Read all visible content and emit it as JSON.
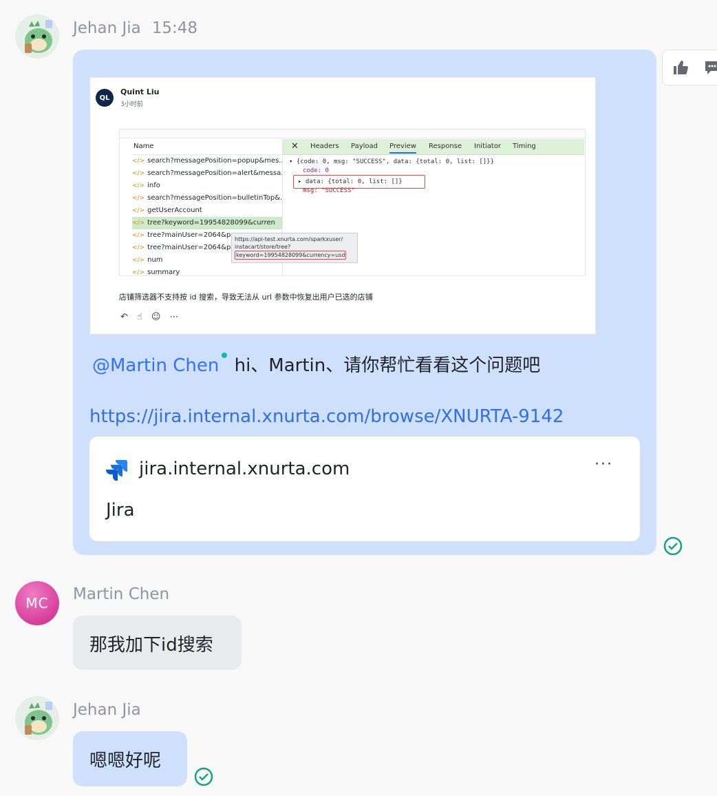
{
  "messages": {
    "m1": {
      "sender": "Jehan Jia",
      "time": "15:48",
      "screenshot": {
        "author_initials": "QL",
        "author_name": "Quint Liu",
        "author_time": "3小时前",
        "devtools": {
          "name_header": "Name",
          "requests": [
            "search?messagePosition=popup&mes...",
            "search?messagePosition=alert&messa...",
            "info",
            "search?messagePosition=bulletinTop&...",
            "getUserAccount",
            "tree?keyword=19954828099&curren",
            "tree?mainUser=2064&pag",
            "tree?mainUser=2064&pag",
            "num",
            "summary"
          ],
          "tabs": [
            "Headers",
            "Payload",
            "Preview",
            "Response",
            "Initiator",
            "Timing"
          ],
          "preview_line1": "▾ {code: 0, msg: \"SUCCESS\", data: {total: 0, list: []}}",
          "preview_code": "code: 0",
          "preview_data": "▸ data: {total: 0, list: []}",
          "preview_msg": "msg: \"SUCCESS\"",
          "tooltip_line1": "https://api-test.xnurta.com/sparkxuser/",
          "tooltip_line2": "instacart/store/tree?",
          "tooltip_line3": "keyword=19954828099&currency=usd"
        },
        "caption": "店铺筛选器不支持按 id 搜索，导致无法从 url 参数中恢复出用户已选的店铺"
      },
      "mention": "@Martin Chen",
      "text": " hi、Martin、请你帮忙看看这个问题吧",
      "url": "https://jira.internal.xnurta.com/browse/XNURTA-9142",
      "card": {
        "domain": "jira.internal.xnurta.com",
        "title": "Jira",
        "more": "···"
      }
    },
    "m2": {
      "initials": "MC",
      "sender": "Martin Chen",
      "text": "那我加下id搜索"
    },
    "m3": {
      "sender": "Jehan Jia",
      "text": "嗯嗯好呢"
    }
  },
  "colors": {
    "accent": "#3370ff",
    "bubble_blue": "#cfe0fc",
    "read_check": "#14a37f"
  }
}
